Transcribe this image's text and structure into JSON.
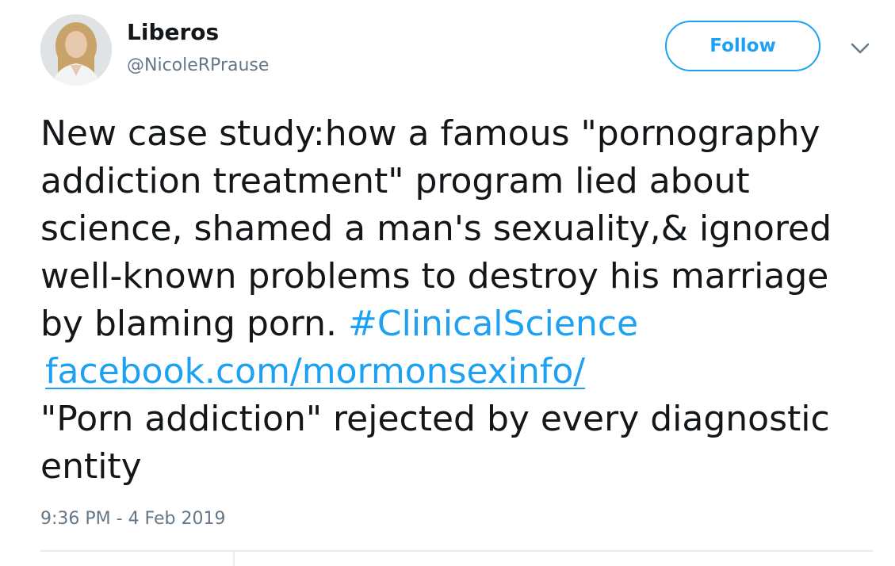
{
  "author": {
    "display_name": "Liberos",
    "handle": "@NicoleRPrause",
    "avatar_icon": "profile-photo"
  },
  "header": {
    "follow_label": "Follow",
    "menu_icon": "chevron-down-icon"
  },
  "tweet": {
    "lines": [
      "New case study:how a famous \"pornography",
      "addiction treatment\" program lied about",
      "science, shamed a man's sexuality,& ignored",
      "well-known problems to destroy his marriage",
      "by blaming porn. "
    ],
    "hashtag": "#ClinicalScience",
    "link": "facebook.com/mormonsexinfo/",
    "tail_lines": [
      "\"Porn addiction\" rejected by every diagnostic",
      "entity"
    ]
  },
  "timestamp": "9:36 PM - 4 Feb 2019",
  "colors": {
    "accent": "#1da1f2",
    "text": "#14171a",
    "muted": "#657786"
  }
}
